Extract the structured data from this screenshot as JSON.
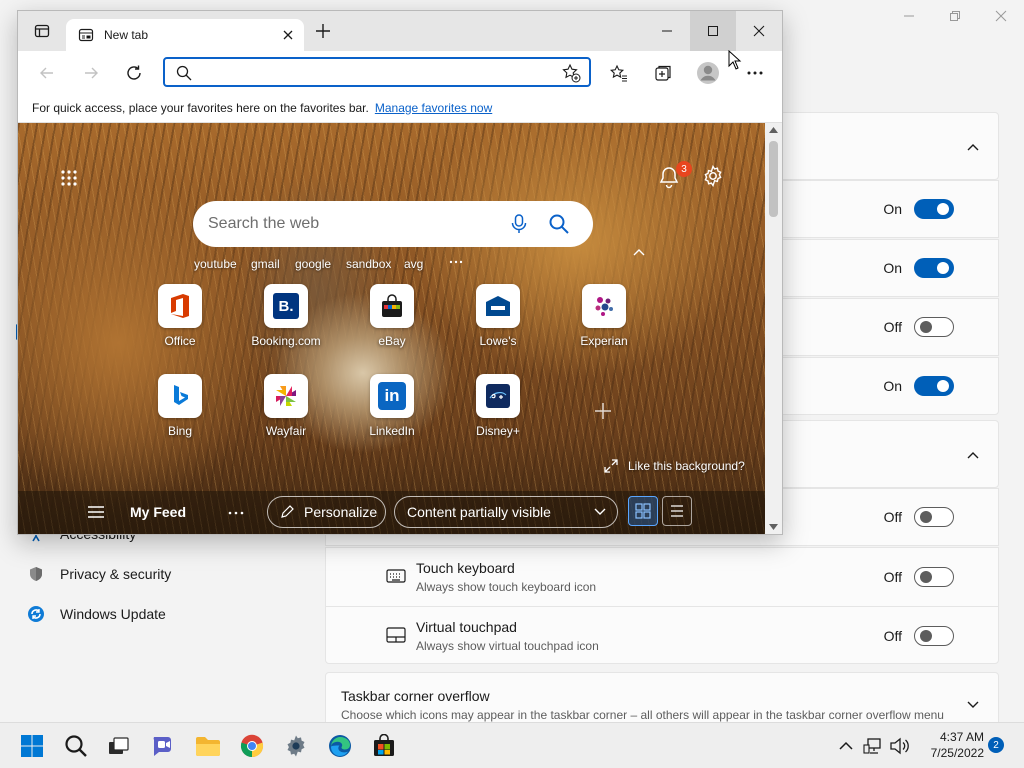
{
  "settings": {
    "nav": [
      {
        "label": "Accessibility",
        "icon": "accessibility-icon"
      },
      {
        "label": "Privacy & security",
        "icon": "shield-icon"
      },
      {
        "label": "Windows Update",
        "icon": "windows-update-icon"
      }
    ],
    "toggle_rows": [
      {
        "state": "On",
        "on": true
      },
      {
        "state": "On",
        "on": true
      },
      {
        "state": "Off",
        "on": false
      },
      {
        "state": "On",
        "on": true
      },
      {
        "state": "Off",
        "on": false
      }
    ],
    "pen_rows": [
      {
        "title": "Touch keyboard",
        "subtitle": "Always show touch keyboard icon",
        "state": "Off",
        "icon": "keyboard-icon"
      },
      {
        "title": "Virtual touchpad",
        "subtitle": "Always show virtual touchpad icon",
        "state": "Off",
        "icon": "touchpad-icon"
      }
    ],
    "overflow": {
      "title": "Taskbar corner overflow",
      "subtitle": "Choose which icons may appear in the taskbar corner – all others will appear in the taskbar corner overflow menu"
    }
  },
  "edge": {
    "tab_title": "New tab",
    "favbar_text": "For quick access, place your favorites here on the favorites bar.",
    "favbar_link": "Manage favorites now",
    "notification_count": "3",
    "search_placeholder": "Search the web",
    "quick_links": [
      "youtube",
      "gmail",
      "google",
      "sandbox",
      "avg"
    ],
    "tiles": [
      {
        "label": "Office"
      },
      {
        "label": "Booking.com"
      },
      {
        "label": "eBay"
      },
      {
        "label": "Lowe's"
      },
      {
        "label": "Experian"
      },
      {
        "label": "Bing"
      },
      {
        "label": "Wayfair"
      },
      {
        "label": "LinkedIn"
      },
      {
        "label": "Disney+"
      }
    ],
    "like_background": "Like this background?",
    "feed": {
      "title": "My Feed",
      "personalize": "Personalize",
      "visibility": "Content partially visible"
    }
  },
  "taskbar": {
    "time": "4:37 AM",
    "date": "7/25/2022",
    "notification_badge": "2"
  }
}
